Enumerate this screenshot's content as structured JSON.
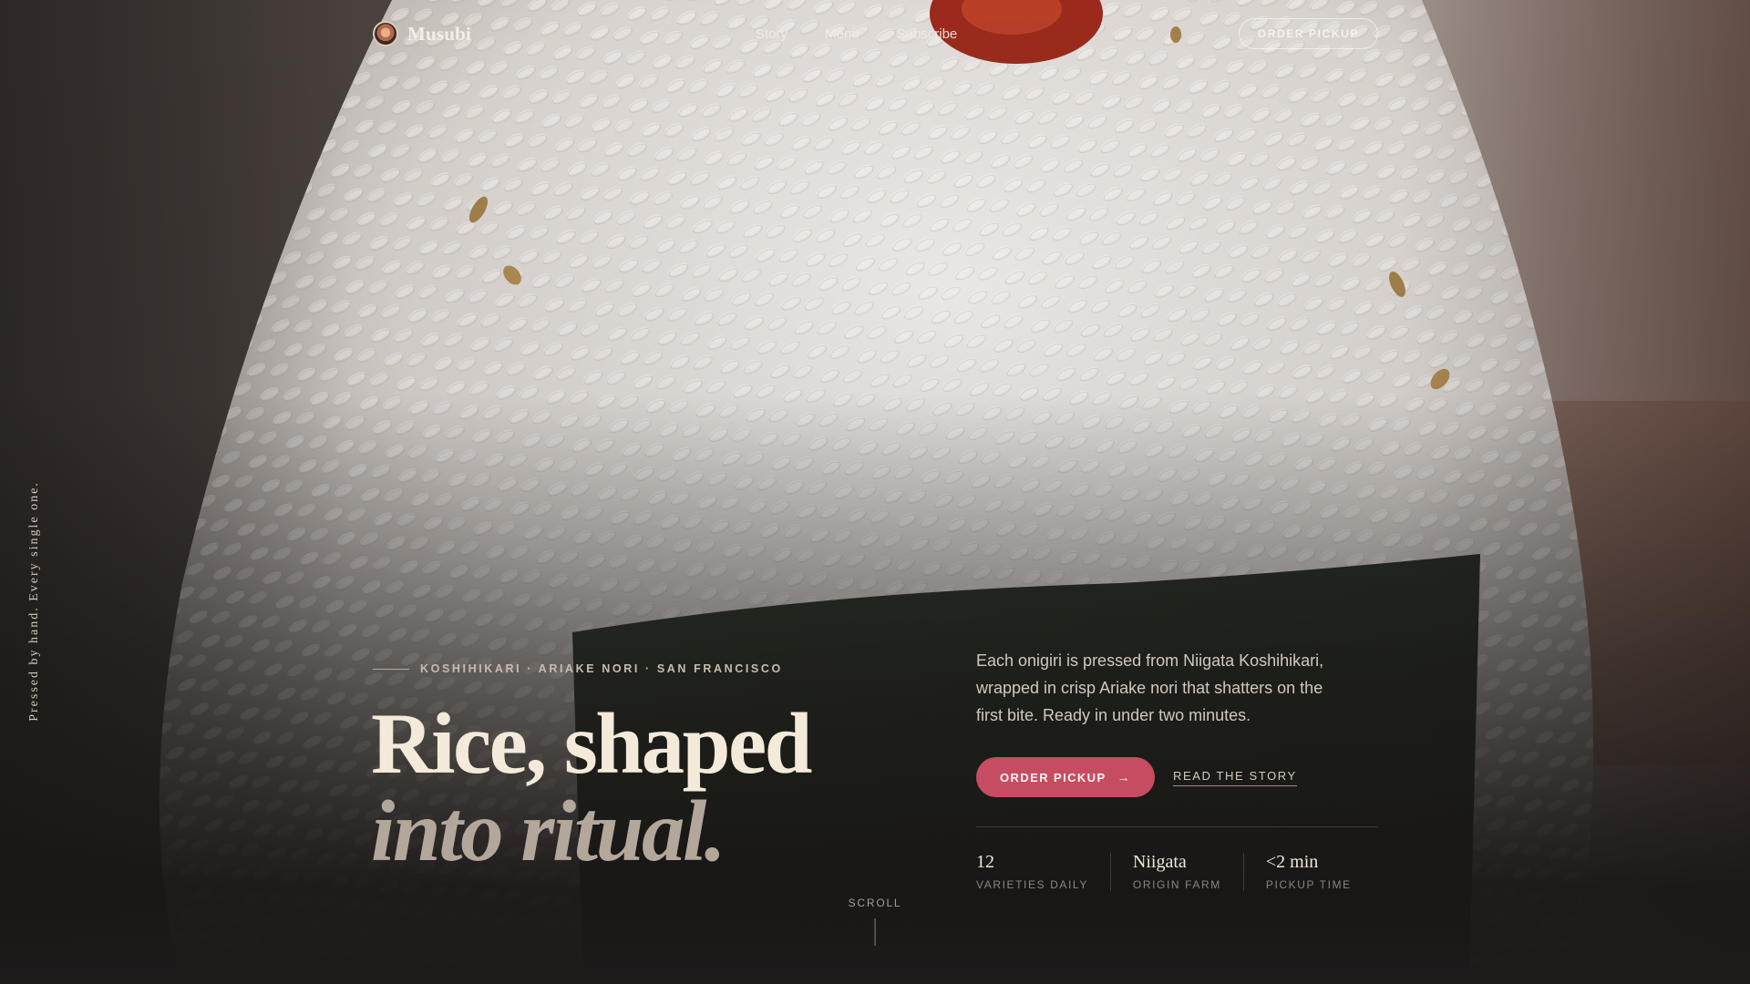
{
  "nav": {
    "brand": "Musubi",
    "links": [
      "Story",
      "Menu",
      "Subscribe"
    ],
    "cta": "ORDER PICKUP"
  },
  "side_tagline": "Pressed by hand. Every single one.",
  "hero": {
    "eyebrow": "KOSHIHIKARI · ARIAKE NORI · SAN FRANCISCO",
    "headline_line1": "Rice, shaped",
    "headline_line2": "into ritual.",
    "intro": "Each onigiri is pressed from Niigata Koshihikari, wrapped in crisp Ariake nori that shatters on the first bite. Ready in under two minutes.",
    "primary_cta": "ORDER PICKUP",
    "primary_cta_icon": "arrow-right-icon",
    "secondary_cta": "READ THE STORY",
    "stats": [
      {
        "value": "12",
        "label": "VARIETIES DAILY"
      },
      {
        "value": "Niigata",
        "label": "ORIGIN FARM"
      },
      {
        "value": "<2 min",
        "label": "PICKUP TIME"
      }
    ]
  },
  "scroll": {
    "label": "SCROLL"
  },
  "colors": {
    "accent": "#c64d61",
    "background": "#1d1b1a",
    "headline": "#f3ead9"
  }
}
